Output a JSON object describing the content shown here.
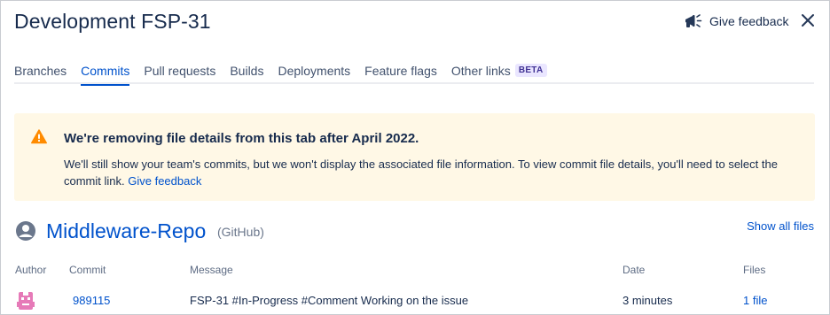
{
  "header": {
    "title": "Development FSP-31",
    "feedback_label": "Give feedback",
    "feedback_icon": "megaphone-icon",
    "close_icon": "close-icon"
  },
  "tabs": [
    {
      "label": "Branches",
      "active": false
    },
    {
      "label": "Commits",
      "active": true
    },
    {
      "label": "Pull requests",
      "active": false
    },
    {
      "label": "Builds",
      "active": false
    },
    {
      "label": "Deployments",
      "active": false
    },
    {
      "label": "Feature flags",
      "active": false
    },
    {
      "label": "Other links",
      "active": false,
      "badge": "BETA"
    }
  ],
  "banner": {
    "icon": "warning-icon",
    "title": "We're removing file details from this tab after April 2022.",
    "text": "We'll still show your team's commits, but we won't display the associated file information. To view commit file details, you'll need to select the commit link.",
    "link": "Give feedback",
    "colors": {
      "background": "#fff8e6",
      "icon": "#ff8b00"
    }
  },
  "repo": {
    "icon": "user-avatar-icon",
    "name": "Middleware-Repo",
    "host": "(GitHub)",
    "show_all": "Show all files"
  },
  "table": {
    "headers": {
      "author": "Author",
      "commit": "Commit",
      "message": "Message",
      "date": "Date",
      "files": "Files"
    },
    "rows": [
      {
        "author_icon": "robot-avatar-icon",
        "commit": "989115",
        "message": "FSP-31 #In-Progress #Comment Working on the issue",
        "date": "3 minutes",
        "files": "1 file"
      }
    ]
  },
  "colors": {
    "accent": "#0052cc",
    "text": "#172b4d",
    "muted": "#6b778c"
  }
}
